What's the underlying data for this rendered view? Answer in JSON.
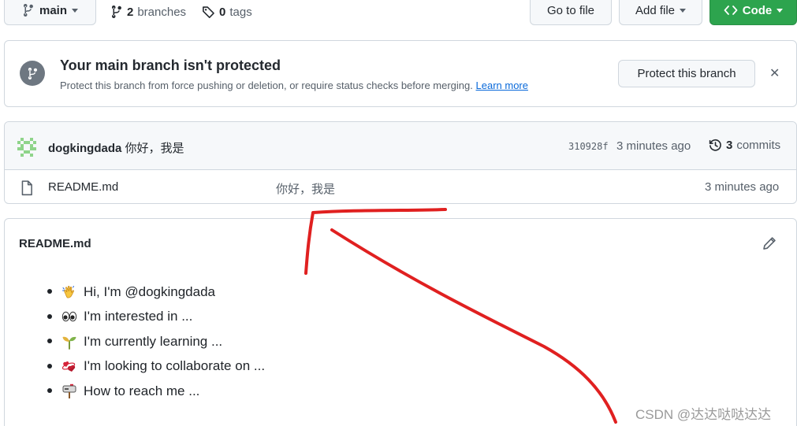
{
  "branch_bar": {
    "branch_name": "main",
    "branches_count": "2",
    "branches_label": "branches",
    "tags_count": "0",
    "tags_label": "tags",
    "go_to_file_label": "Go to file",
    "add_file_label": "Add file",
    "code_label": "Code"
  },
  "protection_banner": {
    "title": "Your main branch isn't protected",
    "description": "Protect this branch from force pushing or deletion, or require status checks before merging.",
    "learn_more": "Learn more",
    "protect_button": "Protect this branch",
    "close_glyph": "✕"
  },
  "latest_commit": {
    "author": "dogkingdada",
    "message": "你好，我是",
    "sha": "310928f",
    "time": "3 minutes ago",
    "commits_count": "3",
    "commits_label": "commits"
  },
  "files": [
    {
      "name": "README.md",
      "message": "你好，我是",
      "time": "3 minutes ago"
    }
  ],
  "readme": {
    "header": "README.md",
    "items": [
      {
        "text": "Hi, I'm @dogkingdada",
        "icon": "waving-hand-icon"
      },
      {
        "text": "I'm interested in ...",
        "icon": "eyes-icon"
      },
      {
        "text": "I'm currently learning ...",
        "icon": "seedling-icon"
      },
      {
        "text": "I'm looking to collaborate on ...",
        "icon": "revolving-hearts-icon"
      },
      {
        "text": "How to reach me ...",
        "icon": "mailbox-icon"
      }
    ]
  },
  "watermark": "CSDN @达达哒哒达达",
  "colors": {
    "code_button": "#2da44e",
    "link": "#0969da",
    "annotation": "#e02020"
  }
}
